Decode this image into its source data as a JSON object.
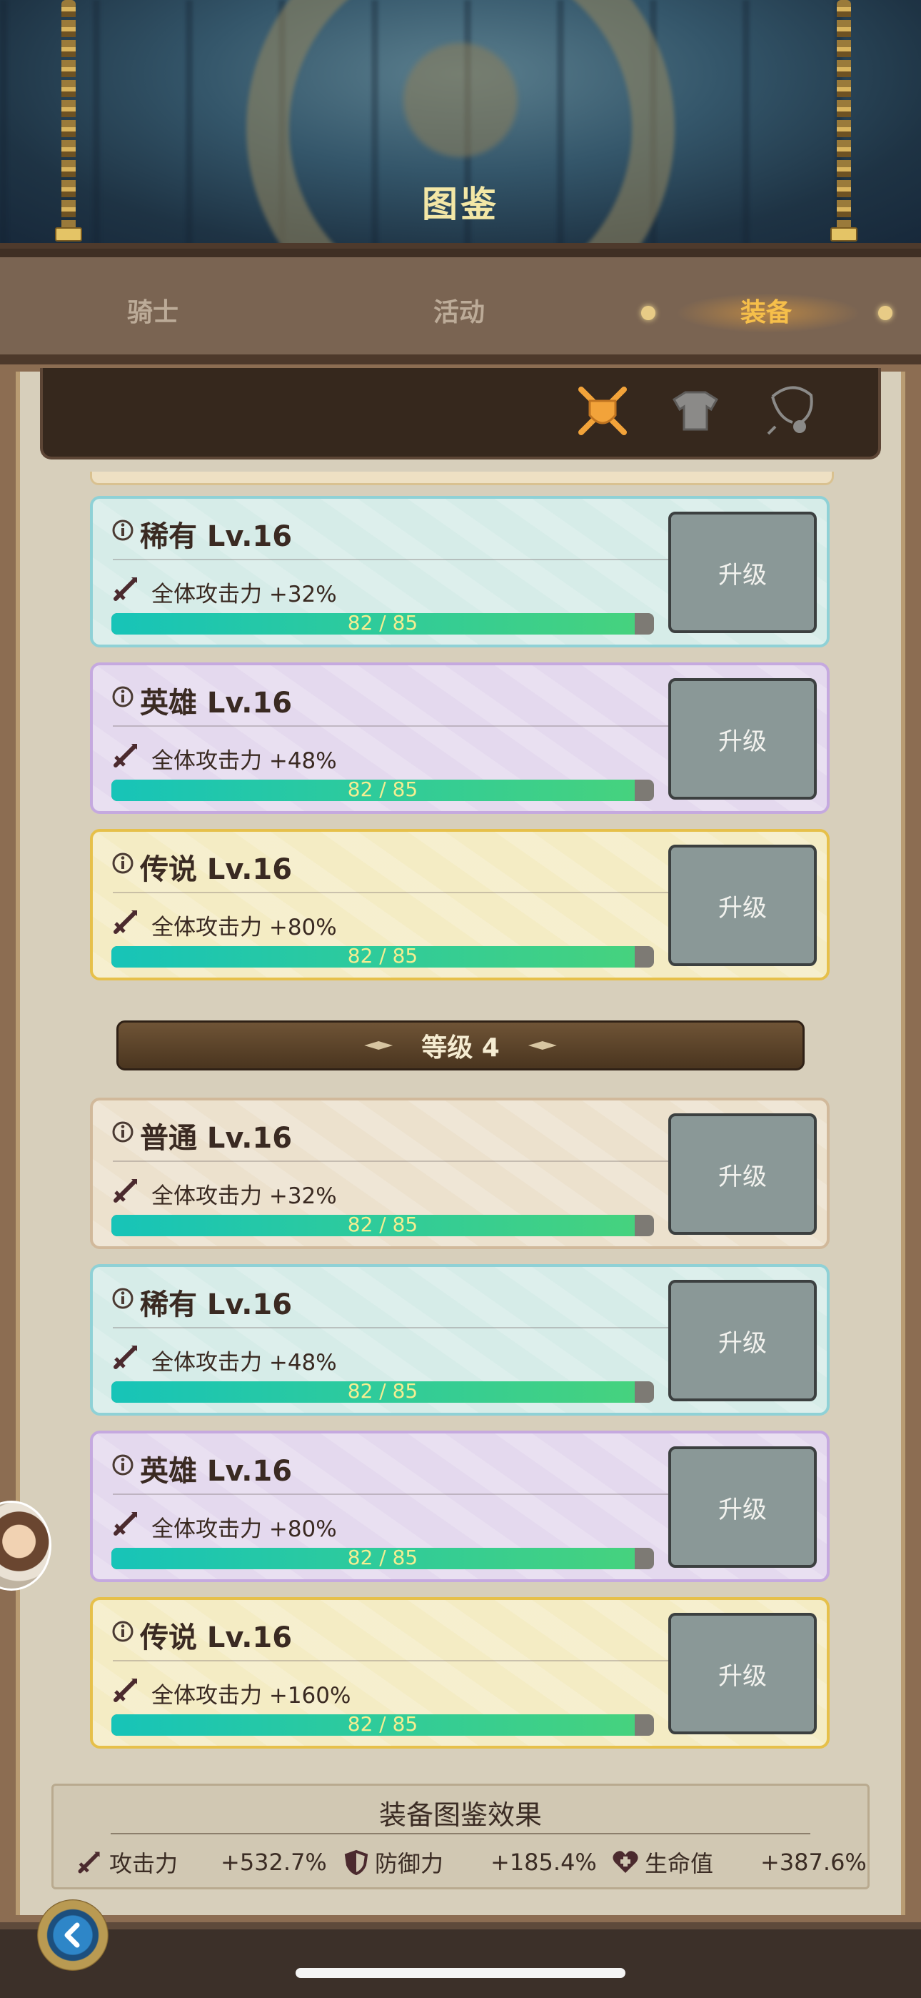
{
  "header": {
    "title": "图鉴"
  },
  "tabs": [
    {
      "label": "骑士",
      "selected": false
    },
    {
      "label": "活动",
      "selected": false
    },
    {
      "label": "装备",
      "selected": true
    }
  ],
  "filters": [
    {
      "icon": "crossed-swords-icon",
      "selected": true
    },
    {
      "icon": "armor-icon",
      "selected": false
    },
    {
      "icon": "necklace-icon",
      "selected": false
    }
  ],
  "level_banner": {
    "label": "等级 4"
  },
  "cards": [
    {
      "title": "稀有 Lv.16",
      "stat": "全体攻击力 +32%",
      "progress_text": "82 / 85",
      "progress": 0.9647,
      "button": "升级",
      "rarity": "rare"
    },
    {
      "title": "英雄 Lv.16",
      "stat": "全体攻击力 +48%",
      "progress_text": "82 / 85",
      "progress": 0.9647,
      "button": "升级",
      "rarity": "hero"
    },
    {
      "title": "传说 Lv.16",
      "stat": "全体攻击力 +80%",
      "progress_text": "82 / 85",
      "progress": 0.9647,
      "button": "升级",
      "rarity": "legend"
    },
    {
      "title": "普通 Lv.16",
      "stat": "全体攻击力 +32%",
      "progress_text": "82 / 85",
      "progress": 0.9647,
      "button": "升级",
      "rarity": "normal"
    },
    {
      "title": "稀有 Lv.16",
      "stat": "全体攻击力 +48%",
      "progress_text": "82 / 85",
      "progress": 0.9647,
      "button": "升级",
      "rarity": "rare"
    },
    {
      "title": "英雄 Lv.16",
      "stat": "全体攻击力 +80%",
      "progress_text": "82 / 85",
      "progress": 0.9647,
      "button": "升级",
      "rarity": "hero"
    },
    {
      "title": "传说 Lv.16",
      "stat": "全体攻击力 +160%",
      "progress_text": "82 / 85",
      "progress": 0.9647,
      "button": "升级",
      "rarity": "legend"
    }
  ],
  "summary": {
    "title": "装备图鉴效果",
    "attack_label": "攻击力",
    "attack_value": "+532.7%",
    "defense_label": "防御力",
    "defense_value": "+185.4%",
    "hp_label": "生命值",
    "hp_value": "+387.6%"
  },
  "colors": {
    "accent": "#f6bf4a",
    "progress_start": "#17c4b8",
    "progress_end": "#46d27e"
  }
}
